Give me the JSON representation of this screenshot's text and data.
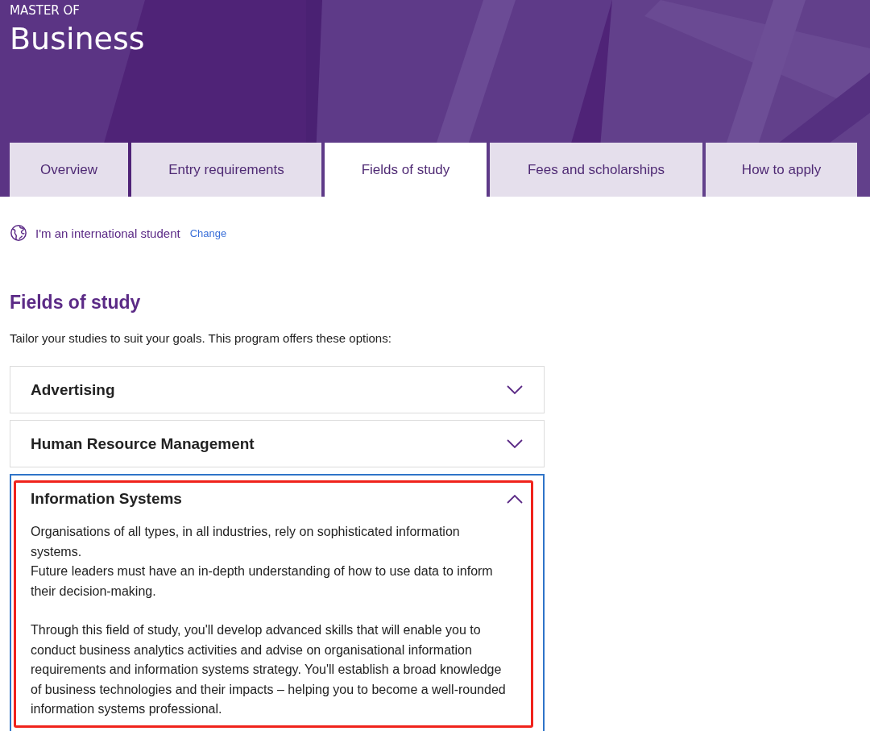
{
  "hero": {
    "eyebrow": "MASTER OF",
    "title": "Business"
  },
  "tabs": [
    {
      "label": "Overview",
      "selected": false
    },
    {
      "label": "Entry requirements",
      "selected": false
    },
    {
      "label": "Fields of study",
      "selected": true
    },
    {
      "label": "Fees and scholarships",
      "selected": false
    },
    {
      "label": "How to apply",
      "selected": false
    }
  ],
  "student_type": {
    "label": "I'm an international student",
    "link": "Change"
  },
  "section": {
    "heading": "Fields of study",
    "intro": "Tailor your studies to suit your goals. This program offers these options:"
  },
  "accordion": [
    {
      "title": "Advertising",
      "expanded": false,
      "highlighted": false
    },
    {
      "title": "Human Resource Management",
      "expanded": false,
      "highlighted": false
    },
    {
      "title": "Information Systems",
      "expanded": true,
      "highlighted": true,
      "paragraphs": [
        [
          "Organisations of all types, in all industries, rely on sophisticated information systems.",
          "Future leaders must have an in-depth understanding of how to use data to inform their decision-making."
        ],
        [
          "Through this field of study, you'll develop advanced skills that will enable you to conduct business analytics activities and advise on organisational information requirements and information systems strategy. You'll establish a broad knowledge of business technologies and their impacts – helping you to become a well-rounded information systems professional."
        ]
      ]
    }
  ]
}
